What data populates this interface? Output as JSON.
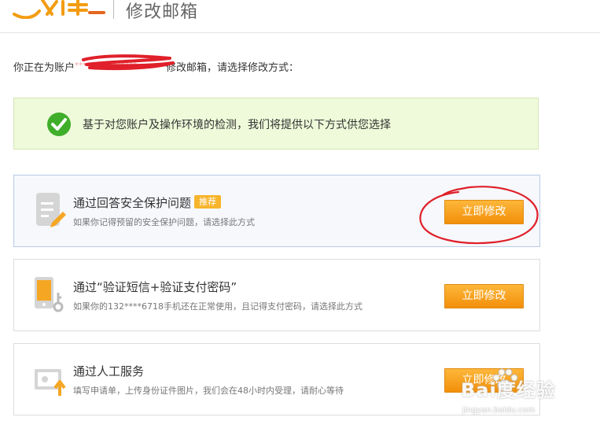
{
  "header": {
    "title": "修改邮箱"
  },
  "intro": {
    "prefix": "你正在为账户",
    "masked_account": "********132****",
    "suffix": "修改邮箱，请选择修改方式："
  },
  "notice": {
    "text": "基于对您账户及操作环境的检测，我们将提供以下方式供您选择"
  },
  "options": [
    {
      "title": "通过回答安全保护问题",
      "badge": "推荐",
      "desc": "如果你记得预留的安全保护问题，请选择此方式",
      "button": "立即修改",
      "icon": "document-pencil-icon"
    },
    {
      "title": "通过“验证短信+验证支付密码”",
      "desc": "如果你的132****6718手机还在正常使用，且记得支付密码，请选择此方式",
      "button": "立即修改",
      "icon": "phone-key-icon"
    },
    {
      "title": "通过人工服务",
      "desc": "填写申请单，上传身份证件图片，我们会在48小时内受理，请耐心等待",
      "button": "立即修改",
      "icon": "id-card-upload-icon"
    }
  ],
  "watermark": {
    "text": "Bai度经验",
    "url": "jingyan.baidu.com"
  },
  "colors": {
    "accent_orange": "#f5a623",
    "notice_bg": "#eefad9",
    "annotation_red": "#e0202a",
    "check_green": "#3fae2a"
  }
}
